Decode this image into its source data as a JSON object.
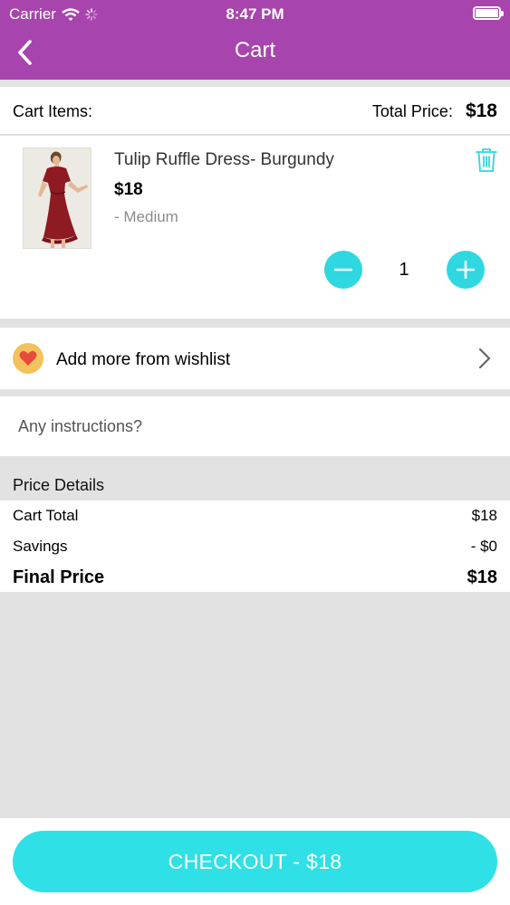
{
  "status_bar": {
    "carrier": "Carrier",
    "time": "8:47 PM"
  },
  "nav": {
    "title": "Cart"
  },
  "cart_summary": {
    "items_label": "Cart Items:",
    "total_label": "Total Price:",
    "total_value": "$18"
  },
  "cart_items": [
    {
      "name": "Tulip Ruffle Dress- Burgundy",
      "price": "$18",
      "variant": "- Medium",
      "quantity": "1"
    }
  ],
  "wishlist": {
    "label": "Add more from wishlist"
  },
  "instructions": {
    "placeholder": "Any instructions?"
  },
  "price_details": {
    "header": "Price Details",
    "rows": [
      {
        "label": "Cart Total",
        "value": "$18"
      },
      {
        "label": "Savings",
        "value": "- $0"
      },
      {
        "label": "Final Price",
        "value": "$18"
      }
    ]
  },
  "checkout": {
    "label": "CHECKOUT - $18"
  },
  "colors": {
    "header": "#a844ad",
    "accent": "#2fd7e1",
    "background": "#e2e2e2",
    "heart_badge": "#f3c25c",
    "heart": "#e84b3c",
    "dress": "#8e1a22"
  }
}
